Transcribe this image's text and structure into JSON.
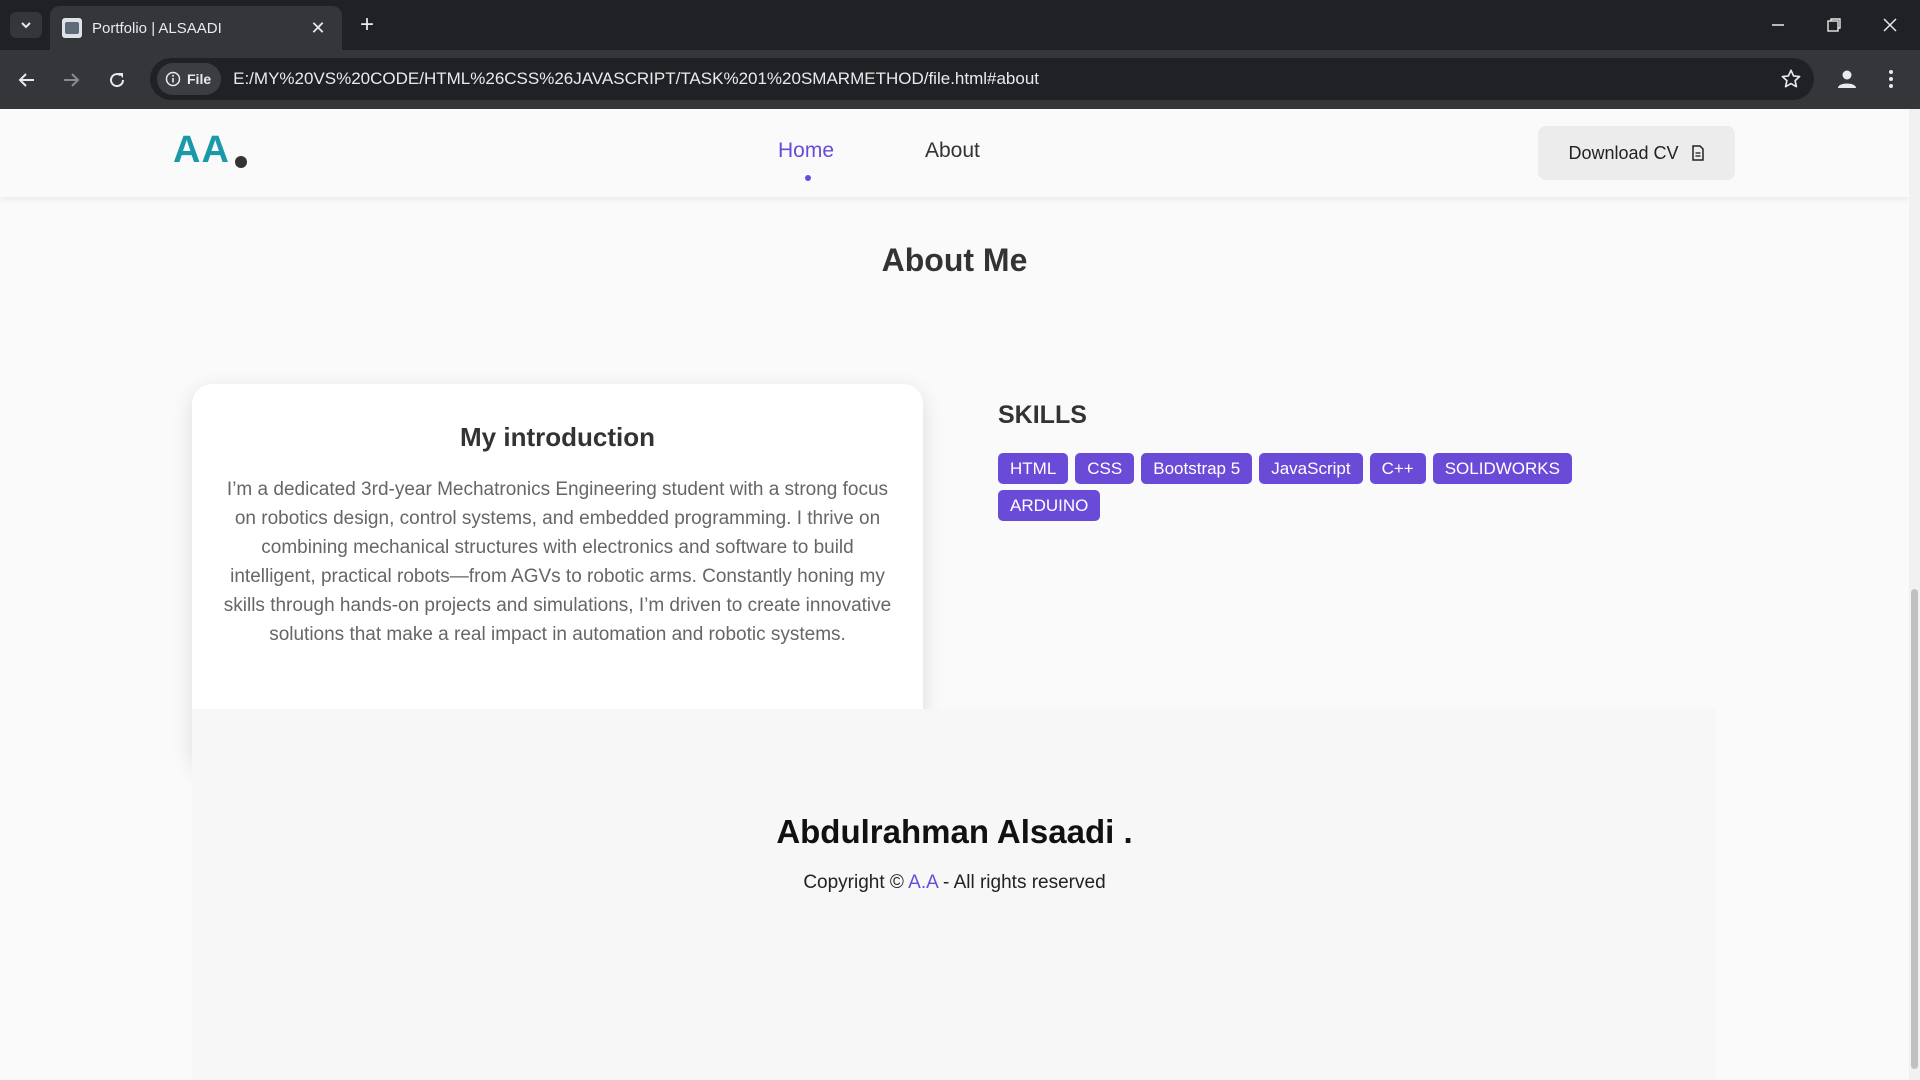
{
  "browser": {
    "tab_title": "Portfolio | ALSAADI",
    "tab_close_glyph": "✕",
    "new_tab_glyph": "+",
    "site_chip_label": "File",
    "url": "E:/MY%20VS%20CODE/HTML%26CSS%26JAVASCRIPT/TASK%201%20SMARMETHOD/file.html#about",
    "icons": [
      "tab-search-icon",
      "back-icon",
      "forward-icon",
      "reload-icon",
      "info-icon",
      "star-icon",
      "profile-icon",
      "kebab-menu-icon",
      "minimize-icon",
      "restore-icon",
      "close-window-icon"
    ]
  },
  "nav": {
    "logo": "AA",
    "links": [
      {
        "label": "Home",
        "active": true
      },
      {
        "label": "About",
        "active": false
      }
    ],
    "download_label": "Download CV"
  },
  "about": {
    "title": "About Me",
    "intro_title": "My introduction",
    "intro_text": "I’m a dedicated 3rd-year Mechatronics Engineering student with a strong focus on robotics design, control systems, and embedded programming. I thrive on combining mechanical structures with electronics and software to build intelligent, practical robots—from AGVs to robotic arms. Constantly honing my skills through hands-on projects and simulations, I’m driven to create innovative solutions that make a real impact in automation and robotic systems."
  },
  "skills": {
    "title": "SKILLS",
    "items": [
      "HTML",
      "CSS",
      "Bootstrap 5",
      "JavaScript",
      "C++",
      "SOLIDWORKS",
      "ARDUINO"
    ]
  },
  "footer": {
    "name": "Abdulrahman Alsaadi .",
    "copy_prefix": "Copyright ©",
    "brand": "A.A",
    "copy_suffix": "- All rights reserved"
  },
  "colors": {
    "accent": "#6a4bd8",
    "logo": "#1a9aa8",
    "chrome_dark": "#202124",
    "chrome_mid": "#35363a"
  }
}
